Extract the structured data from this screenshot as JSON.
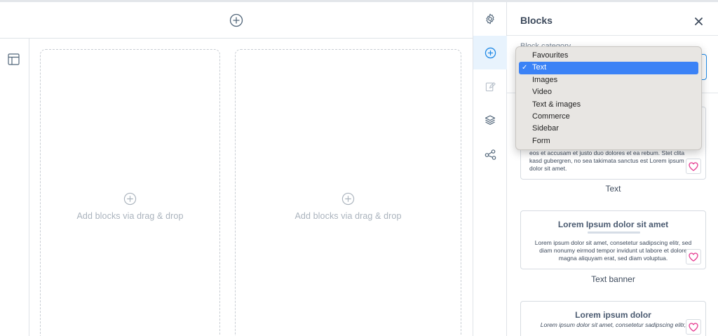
{
  "canvas": {
    "dropzones": [
      {
        "placeholder": "Add blocks via drag & drop"
      },
      {
        "placeholder": "Add blocks via drag & drop"
      }
    ]
  },
  "rail": {
    "items": [
      {
        "icon": "gear-icon",
        "active": false
      },
      {
        "icon": "plus-circle-icon",
        "active": true
      },
      {
        "icon": "edit-icon",
        "active": false
      },
      {
        "icon": "layers-icon",
        "active": false
      },
      {
        "icon": "share-icon",
        "active": false
      }
    ]
  },
  "panel": {
    "title": "Blocks",
    "category_label": "Block category",
    "category_selected": "Text",
    "category_options": [
      "Favourites",
      "Text",
      "Images",
      "Video",
      "Text & images",
      "Commerce",
      "Sidebar",
      "Form"
    ],
    "cards": [
      {
        "name": "Text",
        "text": "eos et accusam et justo duo dolores et ea rebum. Stet clita kasd gubergren, no sea takimata sanctus est Lorem ipsum dolor sit amet."
      },
      {
        "name": "Text banner",
        "title": "Lorem Ipsum dolor sit amet",
        "text": "Lorem ipsum dolor sit amet, consetetur sadipscing elitr, sed diam nonumy eirmod tempor invidunt ut labore et dolore magna aliquyam erat, sed diam voluptua."
      },
      {
        "title": "Lorem ipsum dolor",
        "text": "Lorem ipsum dolor sit amet, consetetur sadipscing elitr,"
      }
    ]
  },
  "colors": {
    "accent": "#1e88e5",
    "heart": "#e6398f",
    "selected_option": "#3b82f6"
  }
}
